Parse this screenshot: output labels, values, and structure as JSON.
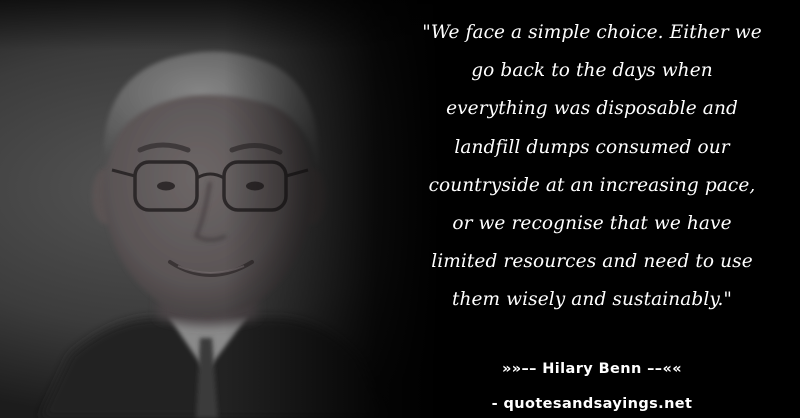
{
  "quote": {
    "text": "\"We face a simple choice. Either we go back to the days when everything was disposable and landfill dumps consumed our countryside at an increasing pace, or we recognise that we have limited resources and need to use them wisely and sustainably.\"",
    "author": "»»–– Hilary Benn ––««",
    "source": "- quotesandsayings.net"
  },
  "colors": {
    "background": "#000000",
    "text": "#ffffff",
    "photo_backdrop": "#4a4a4a"
  }
}
